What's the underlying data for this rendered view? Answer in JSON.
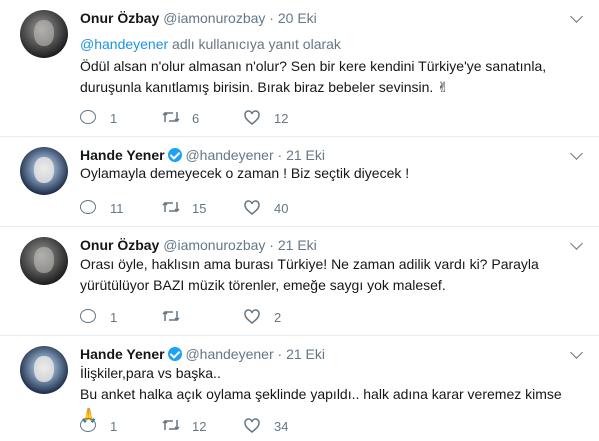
{
  "tweets": [
    {
      "name": "Onur Özbay",
      "handle": "@iamonurozbay",
      "separator": "·",
      "time": "20 Eki",
      "reply_to": {
        "mention": "@handeyener",
        "suffix": " adlı kullanıcıya yanıt olarak"
      },
      "lines": [
        "Ödül alsan n'olur almasan n'olur? Sen bir kere kendini Türkiye'ye sanatınla,",
        "duruşunla kanıtlamış birisin. Bırak biraz bebeler sevinsin. ✌"
      ],
      "replies": "1",
      "retweets": "6",
      "likes": "12"
    },
    {
      "name": "Hande Yener",
      "handle": "@handeyener",
      "separator": "·",
      "time": "21 Eki",
      "lines": [
        "Oylamayla demeyecek o zaman ! Biz seçtik diyecek !"
      ],
      "replies": "11",
      "retweets": "15",
      "likes": "40"
    },
    {
      "name": "Onur Özbay",
      "handle": "@iamonurozbay",
      "separator": "·",
      "time": "21 Eki",
      "lines": [
        "Orası öyle, haklısın ama burası Türkiye! Ne zaman adilik vardı ki? Parayla",
        "yürütülüyor BAZI müzik törenler, emeğe saygı yok malesef."
      ],
      "replies": "1",
      "retweets": "",
      "likes": "2"
    },
    {
      "name": "Hande Yener",
      "handle": "@handeyener",
      "separator": "·",
      "time": "21 Eki",
      "lines": [
        "İlişkiler,para vs başka..",
        "Bu anket halka açık oylama şeklinde yapıldı.. halk adına karar veremez kimse 🙏"
      ],
      "replies": "1",
      "retweets": "12",
      "likes": "34"
    }
  ],
  "icons": {
    "reply": "reply-icon",
    "retweet": "retweet-icon",
    "like": "heart-icon",
    "more": "chevron-down-icon",
    "verified": "verified-badge-icon"
  },
  "colors": {
    "link": "#1b95e0",
    "verified": "#1da1f2",
    "muted": "#657786",
    "divider": "#e6ecf0"
  }
}
